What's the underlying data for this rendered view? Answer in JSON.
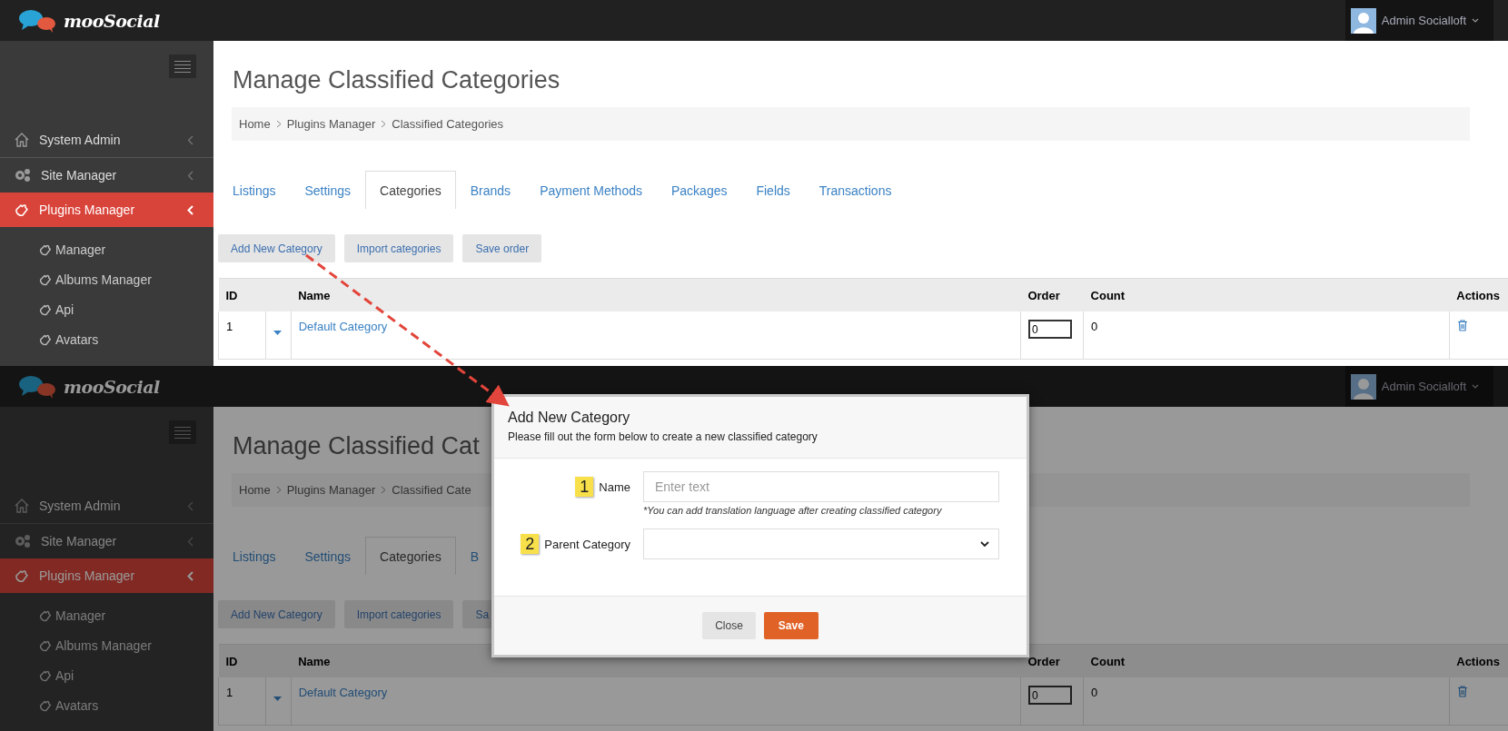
{
  "screens": [
    {
      "dimmed": false,
      "header": {
        "brand": "mooSocial",
        "user": "Admin Socialloft"
      },
      "sidebar": {
        "items": [
          {
            "label": "System Admin",
            "selected": false
          },
          {
            "label": "Site Manager",
            "selected": false
          },
          {
            "label": "Plugins Manager",
            "selected": true,
            "children": [
              {
                "label": "Manager"
              },
              {
                "label": "Albums Manager"
              },
              {
                "label": "Api"
              },
              {
                "label": "Avatars"
              }
            ]
          }
        ]
      },
      "page_title": "Manage Classified Categories",
      "breadcrumb": [
        "Home",
        "Plugins Manager",
        "Classified Categories"
      ],
      "tabs": [
        {
          "label": "Listings",
          "selected": false
        },
        {
          "label": "Settings",
          "selected": false
        },
        {
          "label": "Categories",
          "selected": true
        },
        {
          "label": "Brands",
          "selected": false
        },
        {
          "label": "Payment Methods",
          "selected": false
        },
        {
          "label": "Packages",
          "selected": false
        },
        {
          "label": "Fields",
          "selected": false
        },
        {
          "label": "Transactions",
          "selected": false
        }
      ],
      "buttons": [
        "Add New Category",
        "Import categories",
        "Save order"
      ],
      "table": {
        "columns": [
          "ID",
          "Name",
          "Order",
          "Count",
          "Actions"
        ],
        "rows": [
          {
            "id": "1",
            "name": "Default Category",
            "order": "0",
            "count": "0"
          }
        ]
      }
    },
    {
      "dimmed": true,
      "header": {
        "brand": "mooSocial",
        "user": "Admin Socialloft"
      },
      "sidebar": {
        "items": [
          {
            "label": "System Admin",
            "selected": false
          },
          {
            "label": "Site Manager",
            "selected": false
          },
          {
            "label": "Plugins Manager",
            "selected": true,
            "children": [
              {
                "label": "Manager"
              },
              {
                "label": "Albums Manager"
              },
              {
                "label": "Api"
              },
              {
                "label": "Avatars"
              }
            ]
          }
        ]
      },
      "page_title": "Manage Classified Cat",
      "breadcrumb": [
        "Home",
        "Plugins Manager",
        "Classified Cate"
      ],
      "tabs": [
        {
          "label": "Listings",
          "selected": false
        },
        {
          "label": "Settings",
          "selected": false
        },
        {
          "label": "Categories",
          "selected": true
        },
        {
          "label": "B",
          "selected": false
        }
      ],
      "buttons": [
        "Add New Category",
        "Import categories",
        "Sa"
      ],
      "table": {
        "columns": [
          "ID",
          "Name",
          "Order",
          "Count",
          "Actions"
        ],
        "rows": [
          {
            "id": "1",
            "name": "Default Category",
            "order": "0",
            "count": "0"
          }
        ]
      }
    }
  ],
  "modal": {
    "title": "Add New Category",
    "subtitle": "Please fill out the form below to create a new classified category",
    "fields": [
      {
        "kind": "text",
        "badge": "1",
        "label": "Name",
        "placeholder": "Enter text",
        "hint": "*You can add translation language after creating classified category"
      },
      {
        "kind": "select",
        "badge": "2",
        "label": "Parent Category"
      }
    ],
    "buttons": [
      {
        "label": "Close",
        "kind": "secondary"
      },
      {
        "label": "Save",
        "kind": "primary"
      }
    ]
  }
}
